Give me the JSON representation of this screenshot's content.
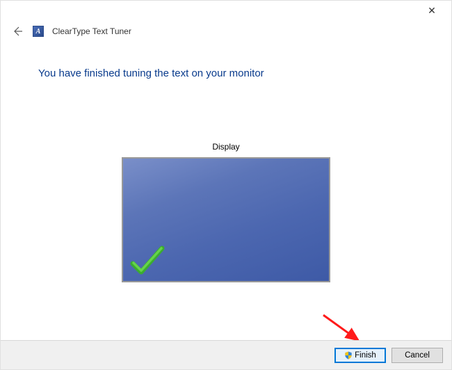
{
  "window": {
    "title": "ClearType Text Tuner",
    "app_icon_letter": "A",
    "close_symbol": "✕"
  },
  "headline": "You have finished tuning the text on your monitor",
  "display": {
    "label": "Display"
  },
  "buttons": {
    "finish": "Finish",
    "cancel": "Cancel"
  },
  "icons": {
    "back_arrow": "←",
    "shield": "shield-icon",
    "checkmark": "checkmark-icon"
  }
}
